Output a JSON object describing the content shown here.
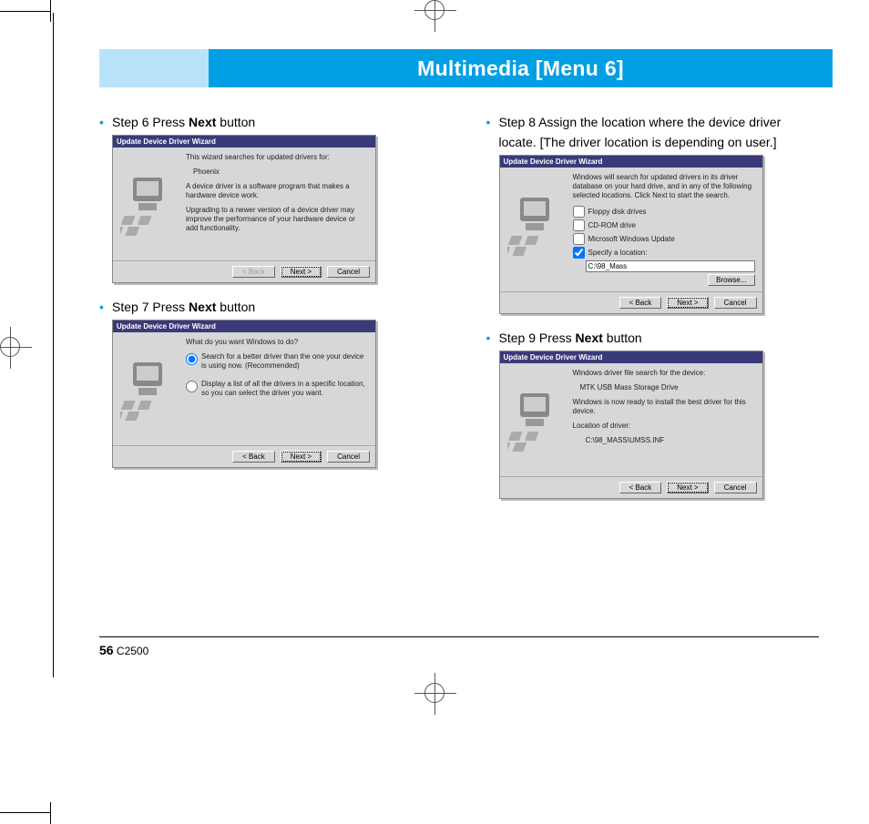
{
  "header": {
    "title": "Multimedia [Menu 6]"
  },
  "footer": {
    "page_number": "56",
    "model": "C2500"
  },
  "left_column": {
    "step6": {
      "pre": "Step 6 Press ",
      "bold": "Next",
      "post": " button",
      "dlg": {
        "title": "Update Device Driver Wizard",
        "line1": "This wizard searches for updated drivers for:",
        "line2": "Phoenix",
        "line3": "A device driver is a software program that makes a hardware device work.",
        "line4": "Upgrading to a newer version of a device driver may improve the performance of your hardware device or add functionality.",
        "back": "< Back",
        "next": "Next >",
        "cancel": "Cancel"
      }
    },
    "step7": {
      "pre": "Step 7 Press ",
      "bold": "Next",
      "post": " button",
      "dlg": {
        "title": "Update Device Driver Wizard",
        "prompt": "What do you want Windows to do?",
        "opt1": "Search for a better driver than the one your device is using now. (Recommended)",
        "opt2": "Display a list of all the drivers in a specific location, so you can select the driver you want.",
        "back": "< Back",
        "next": "Next >",
        "cancel": "Cancel"
      }
    }
  },
  "right_column": {
    "step8": {
      "line1": "Step 8 Assign the location where the device driver",
      "line2": "locate. [The driver location is depending on user.]",
      "dlg": {
        "title": "Update Device Driver Wizard",
        "intro": "Windows will search for updated drivers in its driver database on your hard drive, and in any of the following selected locations. Click Next to start the search.",
        "chk_floppy": "Floppy disk drives",
        "chk_cd": "CD-ROM drive",
        "chk_wu": "Microsoft Windows Update",
        "chk_spec": "Specify a location:",
        "path": "C:\\98_Mass",
        "browse": "Browse...",
        "back": "< Back",
        "next": "Next >",
        "cancel": "Cancel"
      }
    },
    "step9": {
      "pre": "Step 9 Press ",
      "bold": "Next",
      "post": " button",
      "dlg": {
        "title": "Update Device Driver Wizard",
        "line1": "Windows driver file search for the device:",
        "line2": "MTK USB Mass Storage Drive",
        "line3": "Windows is now ready to install the best driver for this device.",
        "loc_label": "Location of driver:",
        "loc_value": "C:\\98_MASS\\UMSS.INF",
        "back": "< Back",
        "next": "Next >",
        "cancel": "Cancel"
      }
    }
  }
}
